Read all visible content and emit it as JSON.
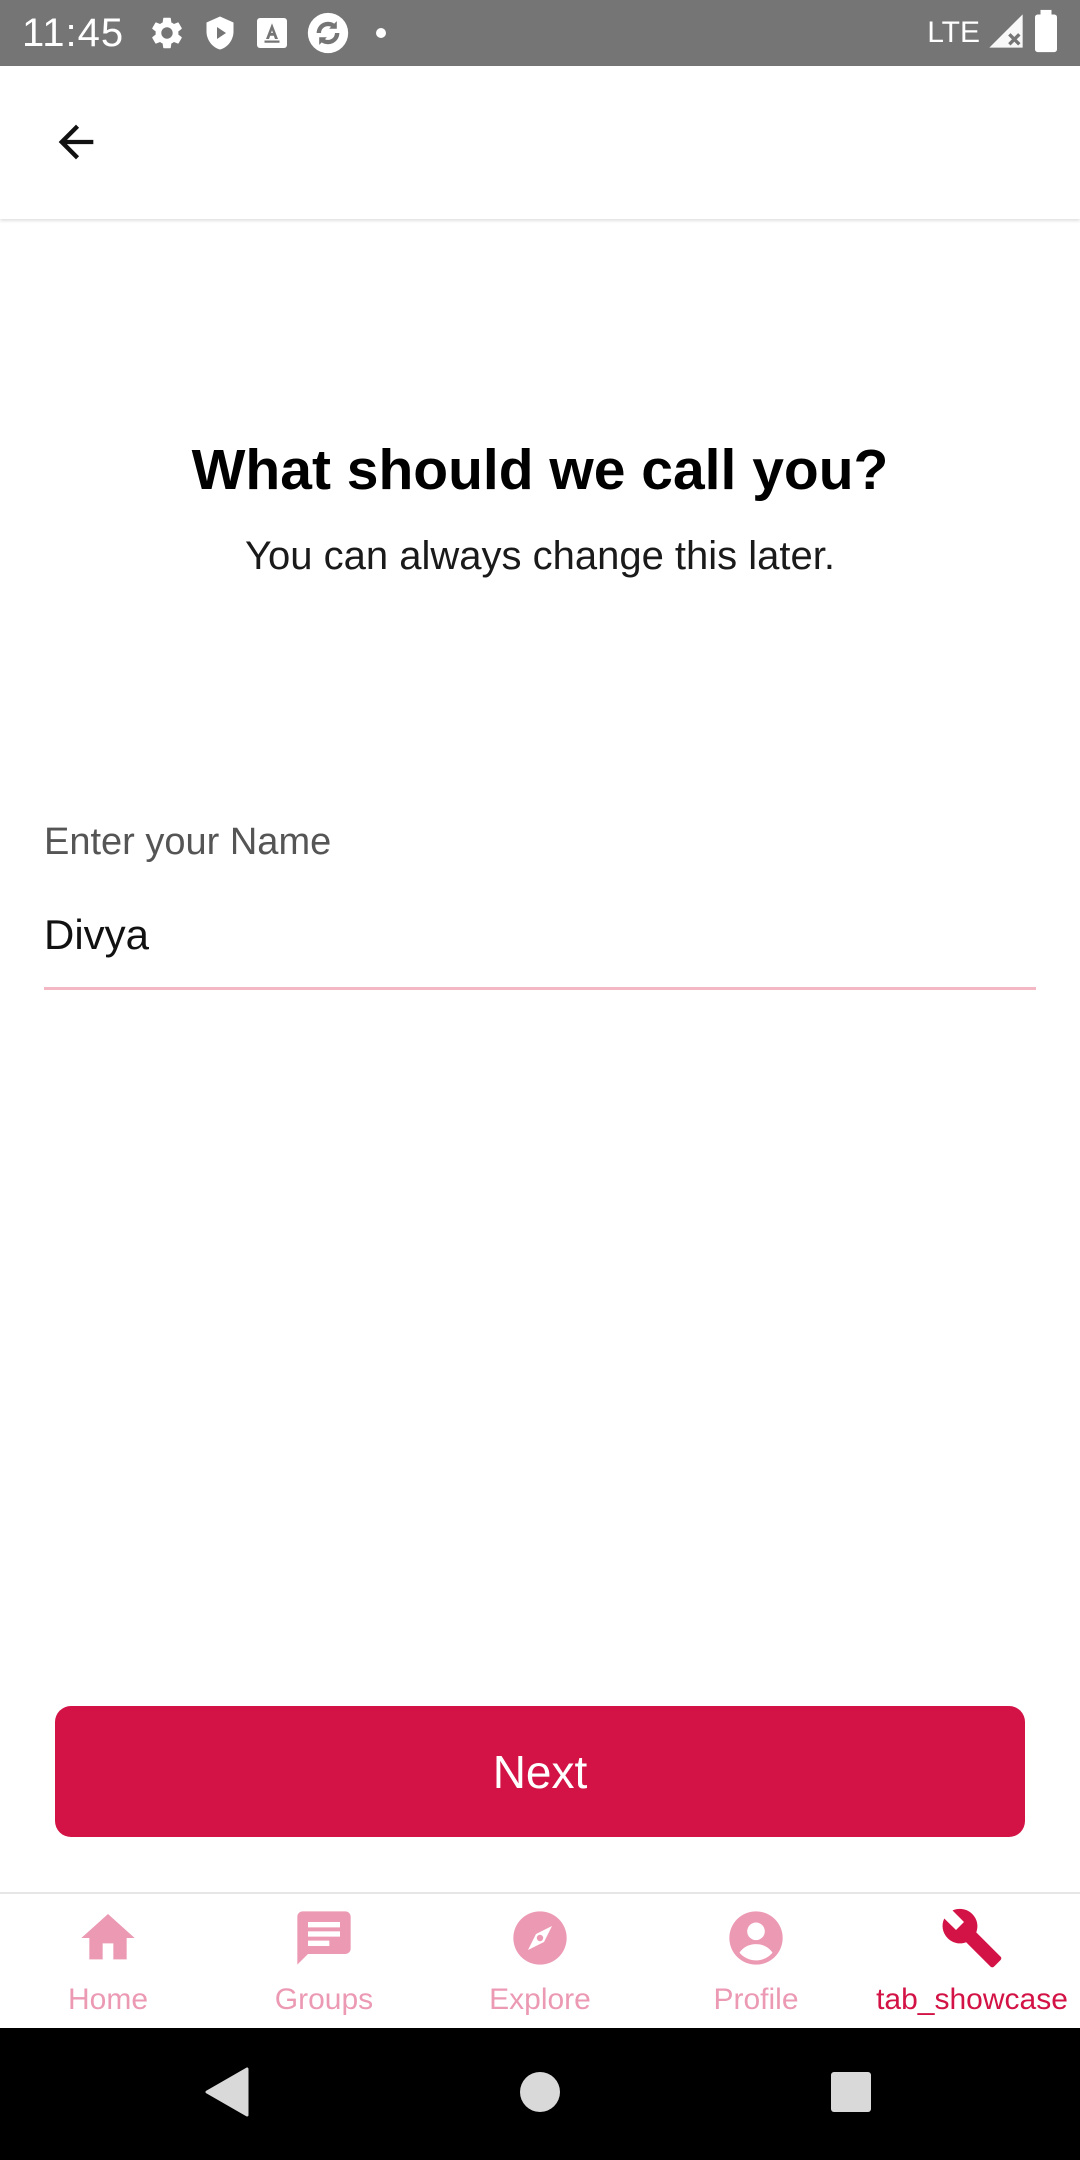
{
  "status_bar": {
    "time": "11:45",
    "network": "LTE",
    "icons": [
      "gear-icon",
      "shield-play-icon",
      "font-a-icon",
      "sync-circle-icon",
      "dot-icon",
      "signal-icon",
      "battery-icon"
    ]
  },
  "app_bar": {
    "back_icon": "arrow-left-icon"
  },
  "main": {
    "title": "What should we call you?",
    "subtitle": "You can always change this later.",
    "name_field": {
      "label": "Enter your Name",
      "value": "Divya"
    },
    "next_label": "Next"
  },
  "bottom_nav": {
    "items": [
      {
        "label": "Home",
        "icon": "home-icon",
        "active": false
      },
      {
        "label": "Groups",
        "icon": "chat-bubble-icon",
        "active": false
      },
      {
        "label": "Explore",
        "icon": "compass-icon",
        "active": false
      },
      {
        "label": "Profile",
        "icon": "account-circle-icon",
        "active": false
      },
      {
        "label": "tab_showcase",
        "icon": "wrench-icon",
        "active": true
      }
    ]
  },
  "colors": {
    "accent": "#d31345",
    "inactive_tab": "#ec9ab4",
    "status_bar": "#757575",
    "input_underline": "#f4b8c4"
  }
}
